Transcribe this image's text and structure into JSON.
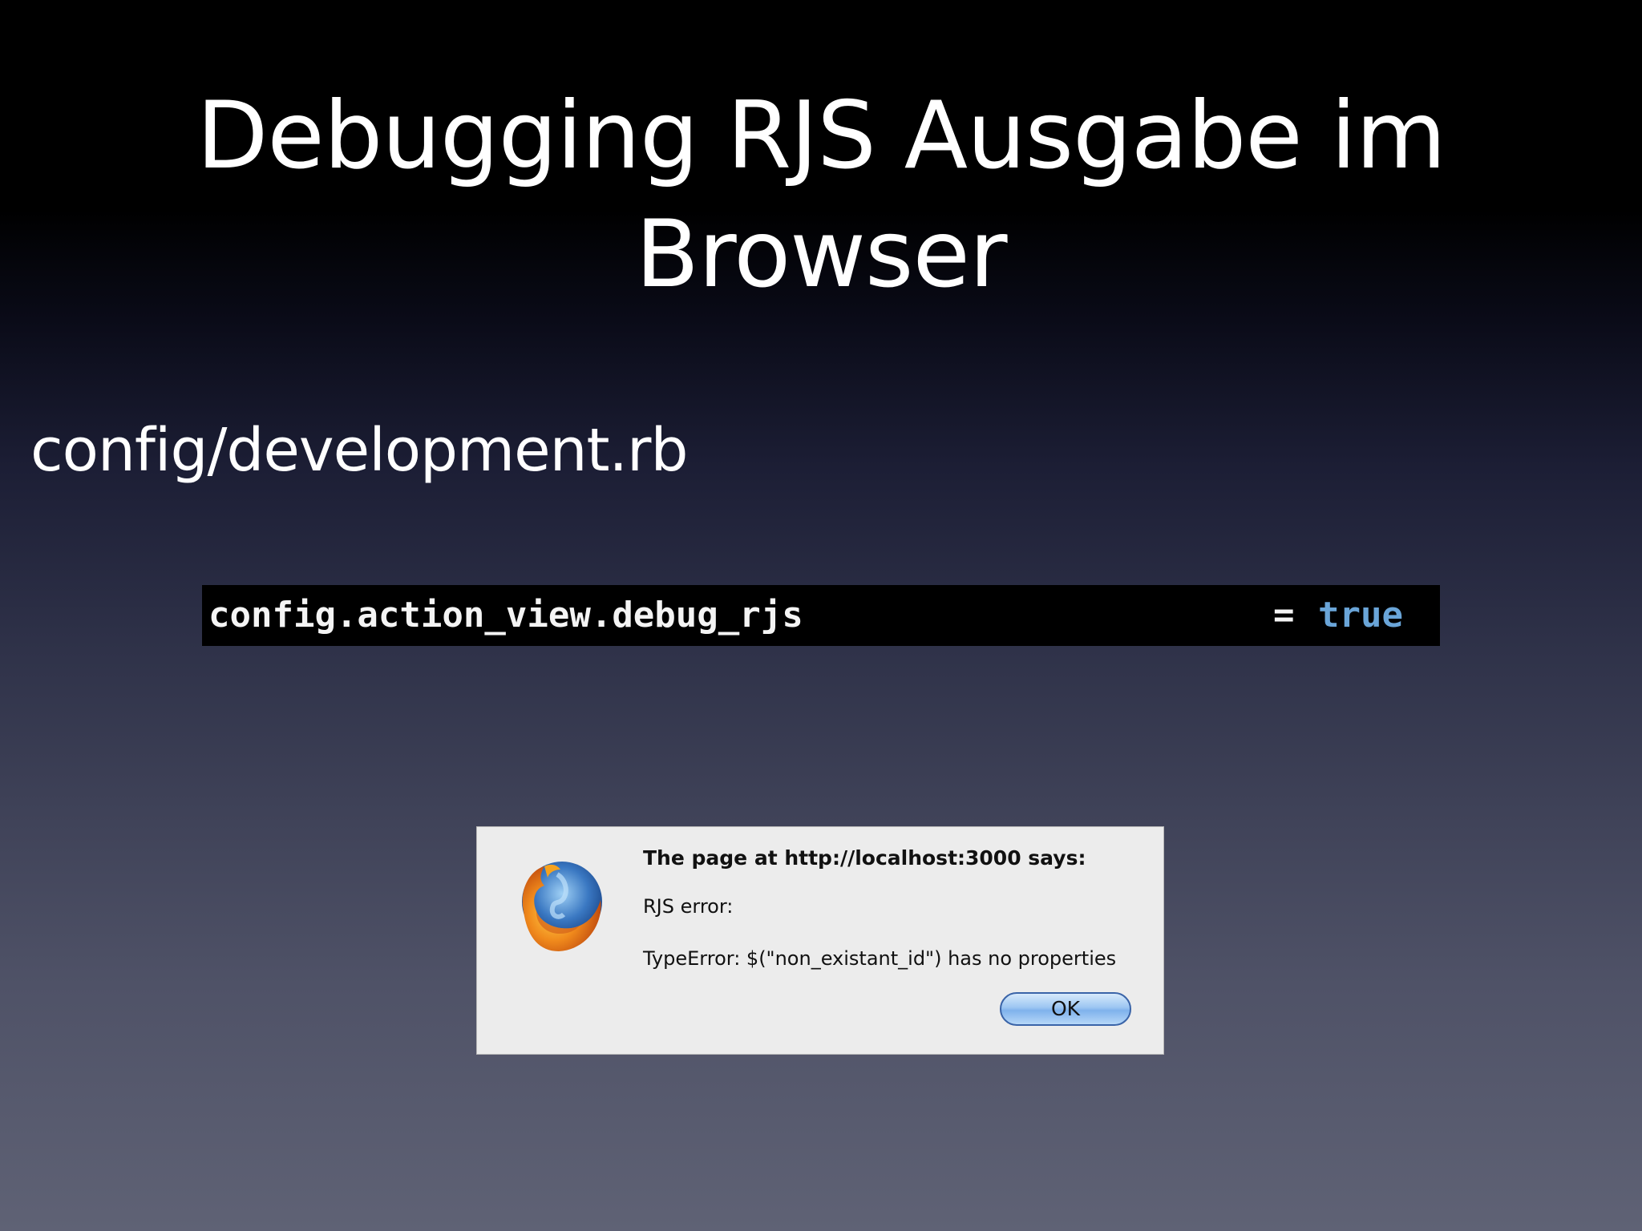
{
  "slide": {
    "title_line1": "Debugging RJS Ausgabe im",
    "title_line2": "Browser",
    "file_path": "config/development.rb"
  },
  "code": {
    "lhs": "config.action_view.debug_rjs",
    "operator": "=",
    "value": "true",
    "value_color": "#6aa5d8",
    "background": "#000000"
  },
  "alert": {
    "icon": "firefox-logo-icon",
    "heading": "The page at http://localhost:3000 says:",
    "line1": "RJS error:",
    "line2": "TypeError: $(\"non_existant_id\") has no properties",
    "ok_label": "OK"
  }
}
